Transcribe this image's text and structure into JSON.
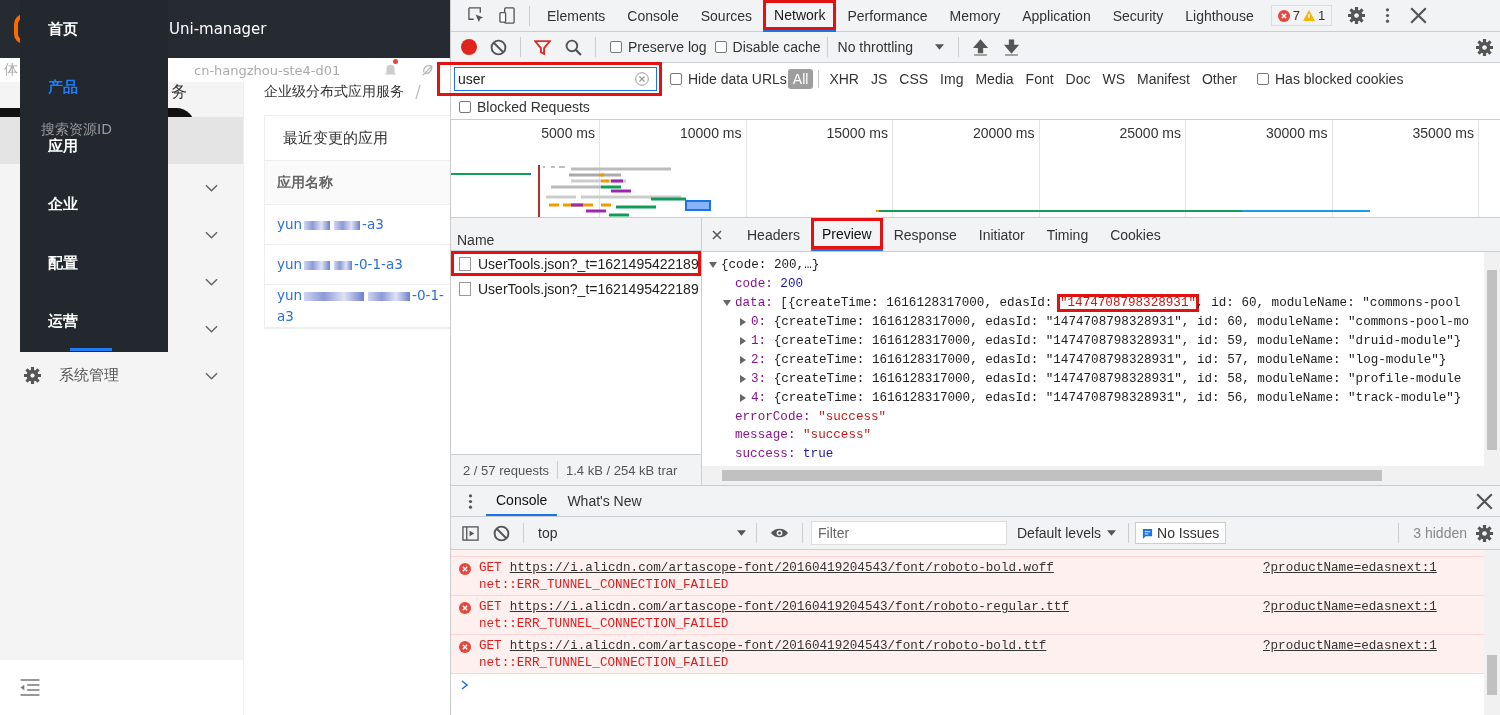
{
  "app": {
    "header": {
      "title": "Uni-manager"
    },
    "menu": [
      {
        "label": "首页",
        "selected": false,
        "indicator": false
      },
      {
        "label": "产品",
        "selected": true,
        "indicator": false
      },
      {
        "label": "应用",
        "selected": false,
        "indicator": false
      },
      {
        "label": "企业",
        "selected": false,
        "indicator": false
      },
      {
        "label": "配置",
        "selected": false,
        "indicator": false
      },
      {
        "label": "运营",
        "selected": false,
        "indicator": true
      }
    ],
    "topbar": {
      "fragment": "体",
      "region": "cn-hangzhou-ste4-d01",
      "notification_dot": true
    },
    "sidebar": {
      "fragment": "务",
      "search": {
        "placeholder": "搜索资源ID"
      },
      "items": [
        {
          "selected": true,
          "expandable": false
        },
        {
          "selected": false,
          "expandable": true
        },
        {
          "selected": false,
          "expandable": true
        },
        {
          "selected": false,
          "expandable": true
        },
        {
          "selected": false,
          "expandable": true
        },
        {
          "label": "系统管理",
          "selected": false,
          "expandable": true
        }
      ]
    },
    "breadcrumb": [
      "企业级分布式应用服务"
    ],
    "card": {
      "title": "最近变更的应用",
      "column": "应用名称",
      "rows": [
        {
          "prefix": "yun",
          "suffix": "-a3"
        },
        {
          "prefix": "yun",
          "suffix": "-0-1-a3"
        },
        {
          "prefix": "yun",
          "suffix": "-0-1-a3"
        }
      ]
    }
  },
  "devtools": {
    "tabs": [
      {
        "label": "Elements",
        "selected": false,
        "annotated": false
      },
      {
        "label": "Console",
        "selected": false,
        "annotated": false
      },
      {
        "label": "Sources",
        "selected": false,
        "annotated": false
      },
      {
        "label": "Network",
        "selected": true,
        "annotated": true
      },
      {
        "label": "Performance",
        "selected": false,
        "annotated": false
      },
      {
        "label": "Memory",
        "selected": false,
        "annotated": false
      },
      {
        "label": "Application",
        "selected": false,
        "annotated": false
      },
      {
        "label": "Security",
        "selected": false,
        "annotated": false
      },
      {
        "label": "Lighthouse",
        "selected": false,
        "annotated": false
      }
    ],
    "errors": "7",
    "warnings": "1",
    "toolbar": {
      "recording": true,
      "filter_active": true,
      "preserve_log": false,
      "disable_cache": false,
      "throttling": "No throttling",
      "preserve_label": "Preserve log",
      "cache_label": "Disable cache"
    },
    "filter": {
      "value": "user",
      "annotated": true,
      "hide_data_urls": false,
      "hide_label": "Hide data URLs",
      "types": [
        {
          "label": "All",
          "selected": true
        },
        {
          "label": "XHR",
          "selected": false
        },
        {
          "label": "JS",
          "selected": false
        },
        {
          "label": "CSS",
          "selected": false
        },
        {
          "label": "Img",
          "selected": false
        },
        {
          "label": "Media",
          "selected": false
        },
        {
          "label": "Font",
          "selected": false
        },
        {
          "label": "Doc",
          "selected": false
        },
        {
          "label": "WS",
          "selected": false
        },
        {
          "label": "Manifest",
          "selected": false
        },
        {
          "label": "Other",
          "selected": false
        }
      ],
      "has_blocked_cookies": false,
      "cookies_label": "Has blocked cookies",
      "blocked_requests": false,
      "blocked_label": "Blocked Requests"
    },
    "timeline": {
      "ticks": [
        "5000 ms",
        "10000 ms",
        "15000 ms",
        "20000 ms",
        "25000 ms",
        "30000 ms",
        "35000 ms"
      ]
    },
    "requests": {
      "header": "Name",
      "rows": [
        {
          "name": "UserTools.json?_t=1621495422189",
          "checked": false,
          "annotated": true
        },
        {
          "name": "UserTools.json?_t=1621495422189",
          "checked": false,
          "annotated": false
        }
      ],
      "summary": [
        "2 / 57 requests",
        "1.4 kB / 254 kB trar"
      ]
    },
    "detail": {
      "tabs": [
        {
          "label": "Headers",
          "selected": false,
          "annotated": false
        },
        {
          "label": "Preview",
          "selected": true,
          "annotated": true
        },
        {
          "label": "Response",
          "selected": false,
          "annotated": false
        },
        {
          "label": "Initiator",
          "selected": false,
          "annotated": false
        },
        {
          "label": "Timing",
          "selected": false,
          "annotated": false
        },
        {
          "label": "Cookies",
          "selected": false,
          "annotated": false
        }
      ],
      "preview": [
        {
          "kind": "root",
          "text": "{code: 200,…}",
          "expanded": true
        },
        {
          "kind": "number",
          "key": "code:",
          "value": "200"
        },
        {
          "kind": "array",
          "key": "data:",
          "before": "[{createTime: 1616128317000, edasId: ",
          "highlight": "\"1474708798328931\"",
          "after": ", id: 60, moduleName: \"commons-pool",
          "expanded": true,
          "children": [
            {
              "key": "0:",
              "value": "{createTime: 1616128317000, edasId: \"1474708798328931\", id: 60, moduleName: \"commons-pool-mo",
              "expanded": false
            },
            {
              "key": "1:",
              "value": "{createTime: 1616128317000, edasId: \"1474708798328931\", id: 59, moduleName: \"druid-module\"}",
              "expanded": false
            },
            {
              "key": "2:",
              "value": "{createTime: 1616128317000, edasId: \"1474708798328931\", id: 57, moduleName: \"log-module\"}",
              "expanded": false
            },
            {
              "key": "3:",
              "value": "{createTime: 1616128317000, edasId: \"1474708798328931\", id: 58, moduleName: \"profile-module",
              "expanded": false
            },
            {
              "key": "4:",
              "value": "{createTime: 1616128317000, edasId: \"1474708798328931\", id: 56, moduleName: \"track-module\"}",
              "expanded": false
            }
          ]
        },
        {
          "kind": "string",
          "key": "errorCode:",
          "value": "\"success\""
        },
        {
          "kind": "string",
          "key": "message:",
          "value": "\"success\""
        },
        {
          "kind": "boolean",
          "key": "success:",
          "value": "true"
        }
      ]
    },
    "drawer": {
      "tabs": [
        {
          "label": "Console",
          "selected": true
        },
        {
          "label": "What's New",
          "selected": false
        }
      ],
      "context": "top",
      "filter": {
        "placeholder": "Filter"
      },
      "levels": "Default levels",
      "issues": "No Issues",
      "hidden": "3 hidden",
      "messages": [
        {
          "method": "GET",
          "url": "https://i.alicdn.com/artascope-font/20160419204543/font/roboto-bold.woff",
          "source": "?productName=edasnext:1",
          "error": "net::ERR_TUNNEL_CONNECTION_FAILED"
        },
        {
          "method": "GET",
          "url": "https://i.alicdn.com/artascope-font/20160419204543/font/roboto-regular.ttf",
          "source": "?productName=edasnext:1",
          "error": "net::ERR_TUNNEL_CONNECTION_FAILED"
        },
        {
          "method": "GET",
          "url": "https://i.alicdn.com/artascope-font/20160419204543/font/roboto-bold.ttf",
          "source": "?productName=edasnext:1",
          "error": "net::ERR_TUNNEL_CONNECTION_FAILED"
        }
      ]
    }
  }
}
